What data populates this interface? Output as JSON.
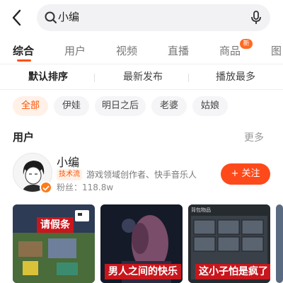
{
  "search": {
    "query": "小编"
  },
  "tabs": [
    {
      "label": "综合",
      "active": true
    },
    {
      "label": "用户"
    },
    {
      "label": "视频"
    },
    {
      "label": "直播"
    },
    {
      "label": "商品",
      "badge": "新"
    },
    {
      "label": "图"
    }
  ],
  "sorts": [
    {
      "label": "默认排序",
      "active": true
    },
    {
      "label": "最新发布"
    },
    {
      "label": "播放最多"
    }
  ],
  "chips": [
    {
      "label": "全部",
      "active": true
    },
    {
      "label": "伊娃"
    },
    {
      "label": "明日之后"
    },
    {
      "label": "老婆"
    },
    {
      "label": "姑娘"
    }
  ],
  "users_section": {
    "title": "用户",
    "more": "更多"
  },
  "user": {
    "name": "小编",
    "tag": "技术流",
    "description": "游戏领域创作者、快手音乐人",
    "fans": "粉丝：118.8w",
    "follow_label": "+ 关注"
  },
  "videos": [
    {
      "caption": "请假条"
    },
    {
      "caption": "男人之间的快乐"
    },
    {
      "caption": "这小子怕是疯了"
    }
  ],
  "video_overlays": {
    "v3_header": "背包物品"
  },
  "colors": {
    "accent": "#fe5200",
    "follow": "#fe4a1a",
    "caption_bg": "#c8161d"
  }
}
